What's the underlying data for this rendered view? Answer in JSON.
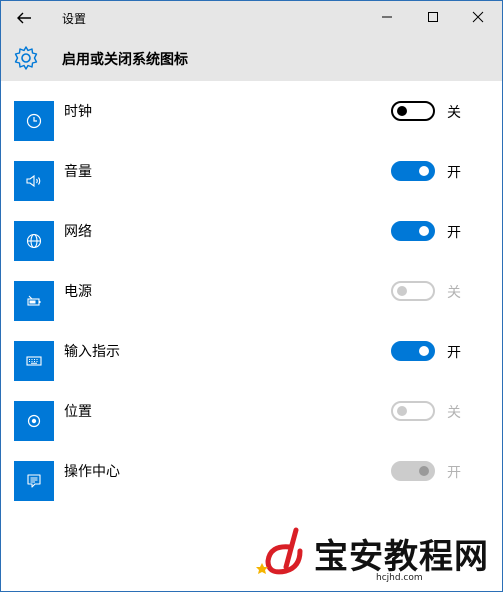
{
  "window": {
    "title": "设置",
    "header_title": "启用或关闭系统图标"
  },
  "rows": [
    {
      "label": "时钟",
      "state": "关",
      "status": "off",
      "icon": "clock-icon"
    },
    {
      "label": "音量",
      "state": "开",
      "status": "on",
      "icon": "volume-icon"
    },
    {
      "label": "网络",
      "state": "开",
      "status": "on",
      "icon": "network-globe-icon"
    },
    {
      "label": "电源",
      "state": "关",
      "status": "off-disabled",
      "icon": "battery-icon"
    },
    {
      "label": "输入指示",
      "state": "开",
      "status": "on",
      "icon": "keyboard-icon"
    },
    {
      "label": "位置",
      "state": "关",
      "status": "off-disabled",
      "icon": "location-icon"
    },
    {
      "label": "操作中心",
      "state": "开",
      "status": "on-disabled",
      "icon": "action-center-icon"
    }
  ],
  "watermark": {
    "name": "宝安教程网",
    "url": "hcjhd.com"
  },
  "colors": {
    "accent": "#0078d7",
    "titlebar_bg": "#e6e6e6",
    "disabled": "#cccccc"
  }
}
